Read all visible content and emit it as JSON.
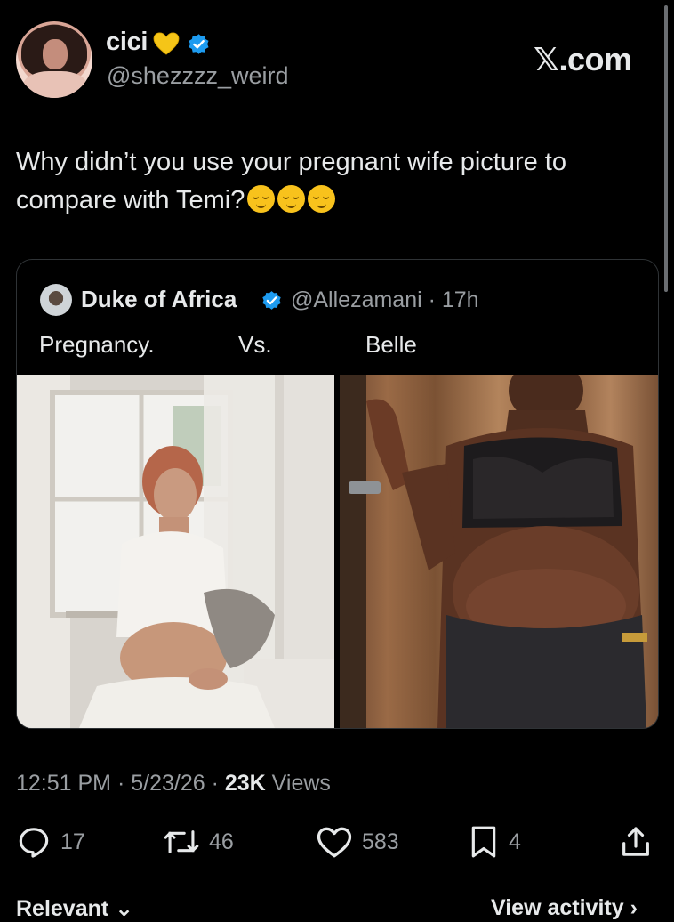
{
  "author": {
    "display_name": "cici",
    "handle": "@shezzzz_weird",
    "emoji_name": "yellow-heart-icon"
  },
  "brand": "𝕏.com",
  "tweet": {
    "text": "Why didn’t you use your pregnant wife picture to compare with Temi?",
    "emojis": [
      "relieved-face-icon",
      "relieved-face-icon",
      "relieved-face-icon"
    ]
  },
  "quote": {
    "display_name": "Duke of Africa",
    "handle_time": "@Allezamani · 17h",
    "text_parts": [
      "Pregnancy.",
      "Vs.",
      "Belle"
    ]
  },
  "meta": {
    "time": "12:51 PM · 5/23/26 · ",
    "views_count": "23K",
    "views_label": " Views"
  },
  "actions": {
    "replies": "17",
    "reposts": "46",
    "likes": "583",
    "bookmarks": "4"
  },
  "bottom": {
    "tab": "Relevant",
    "link": "View activity"
  },
  "colors": {
    "background": "#000000",
    "text": "#e7e9ea",
    "secondary": "#9a9ea2",
    "verified": "#1d9bf0",
    "border": "#2f3336"
  }
}
